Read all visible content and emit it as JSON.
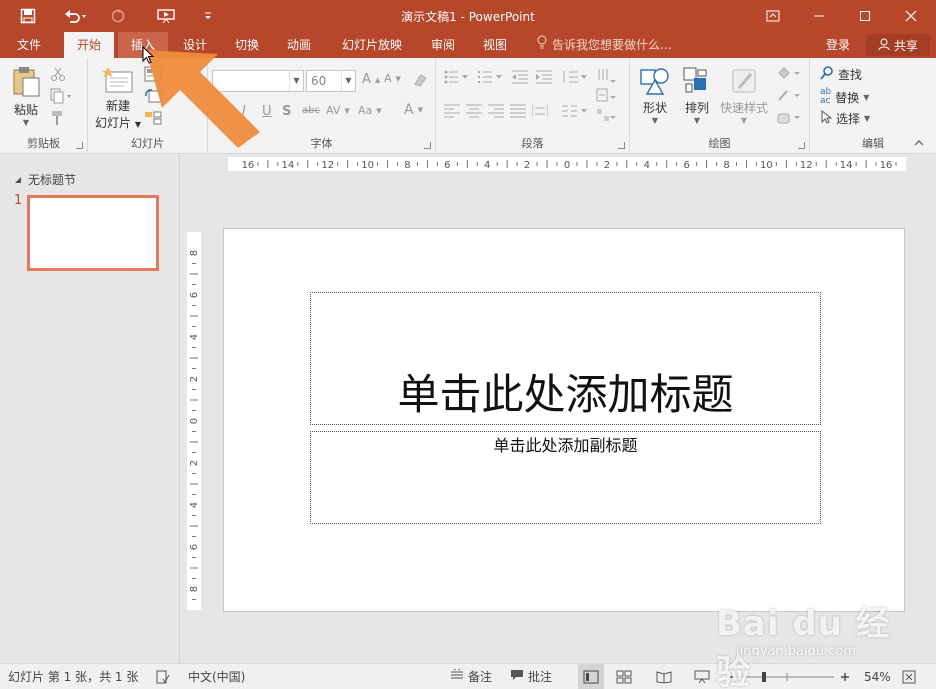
{
  "window": {
    "title": "演示文稿1 - PowerPoint",
    "minimize": "—",
    "maximize": "☐",
    "close": "✕"
  },
  "tabs": [
    {
      "label": "文件",
      "state": "normal"
    },
    {
      "label": "开始",
      "state": "active"
    },
    {
      "label": "插入",
      "state": "hover"
    },
    {
      "label": "设计",
      "state": "normal"
    },
    {
      "label": "切换",
      "state": "normal"
    },
    {
      "label": "动画",
      "state": "normal"
    },
    {
      "label": "幻灯片放映",
      "state": "normal"
    },
    {
      "label": "审阅",
      "state": "normal"
    },
    {
      "label": "视图",
      "state": "normal"
    }
  ],
  "tellme": "告诉我您想要做什么...",
  "login": "登录",
  "share": "共享",
  "ribbon": {
    "clipboard": {
      "label": "剪贴板",
      "paste": "粘贴"
    },
    "slides": {
      "label": "幻灯片",
      "new_slide": "新建",
      "new_slide_2": "幻灯片"
    },
    "font": {
      "label": "字体",
      "size": "60"
    },
    "paragraph": {
      "label": "段落"
    },
    "drawing": {
      "label": "绘图",
      "shapes": "形状",
      "arrange": "排列",
      "quick_styles": "快速样式"
    },
    "editing": {
      "label": "编辑",
      "find": "查找",
      "replace": "替换",
      "select": "选择"
    }
  },
  "thumbnails": {
    "section": "无标题节",
    "slide_number": "1"
  },
  "ruler": {
    "h_labels": [
      "16",
      "14",
      "12",
      "10",
      "8",
      "6",
      "4",
      "2",
      "0",
      "2",
      "4",
      "6",
      "8",
      "10",
      "12",
      "14",
      "16"
    ],
    "v_labels": [
      "8",
      "6",
      "4",
      "2",
      "0",
      "2",
      "4",
      "6",
      "8"
    ]
  },
  "slide": {
    "title_placeholder": "单击此处添加标题",
    "subtitle_placeholder": "单击此处添加副标题"
  },
  "status": {
    "slide_info": "幻灯片 第 1 张，共 1 张",
    "language": "中文(中国)",
    "notes": "备注",
    "comments": "批注",
    "zoom": "54%"
  },
  "watermark": {
    "brand": "Bai du 经验",
    "url": "jingyan.baidu.com"
  },
  "colors": {
    "accent": "#b7472a",
    "thumb_border": "#e9775a",
    "arrow": "#ef8b3b"
  }
}
